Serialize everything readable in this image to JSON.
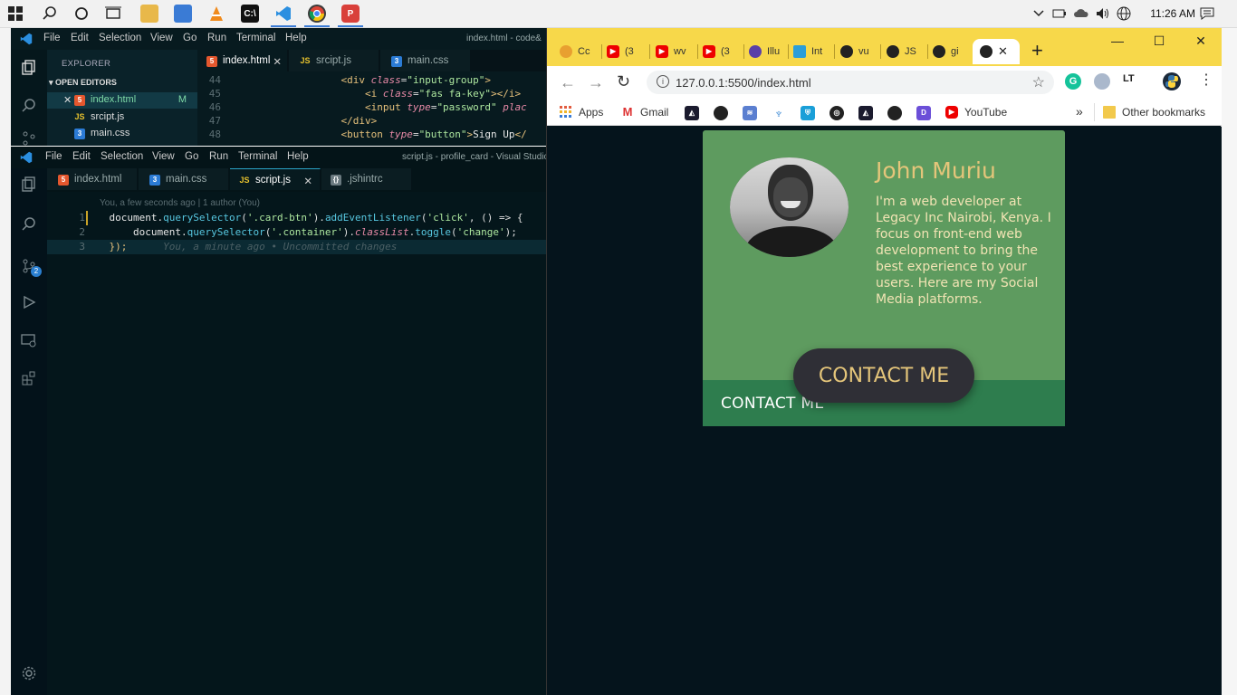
{
  "taskbar": {
    "clock": "11:26 AM"
  },
  "vscode_top": {
    "menu": [
      "File",
      "Edit",
      "Selection",
      "View",
      "Go",
      "Run",
      "Terminal",
      "Help"
    ],
    "title": "index.html - code&",
    "explorer_label": "EXPLORER",
    "open_editors_label": "OPEN EDITORS",
    "files": [
      {
        "name": "index.html",
        "status": "M"
      },
      {
        "name": "srcipt.js"
      },
      {
        "name": "main.css"
      }
    ],
    "tabs": [
      "index.html",
      "srcipt.js",
      "main.css"
    ],
    "code_lines": [
      {
        "n": "44",
        "tag_open": "<div ",
        "attr": "class",
        "eq": "=",
        "val": "\"input-group\"",
        "close": ">"
      },
      {
        "n": "45",
        "tag_open": "<i ",
        "attr": "class",
        "eq": "=",
        "val": "\"fas fa-key\"",
        "close": "></i>"
      },
      {
        "n": "46",
        "tag_open": "<input ",
        "attr": "type",
        "eq": "=",
        "val": "\"password\"",
        "rest": " plac"
      },
      {
        "n": "47",
        "tag_open": "</div>"
      },
      {
        "n": "48",
        "tag_open": "<button ",
        "attr": "type",
        "eq": "=",
        "val": "\"button\"",
        "close": ">",
        "text": "Sign Up",
        "end": "</"
      }
    ]
  },
  "vscode_bottom": {
    "menu": [
      "File",
      "Edit",
      "Selection",
      "View",
      "Go",
      "Run",
      "Terminal",
      "Help"
    ],
    "title": "script.js - profile_card - Visual Studio",
    "tabs": [
      "index.html",
      "main.css",
      "script.js",
      ".jshintrc"
    ],
    "blame": "You, a few seconds ago | 1 author (You)",
    "badge": "2",
    "lines": [
      {
        "n": "1",
        "a": "document.",
        "fn": "querySelector",
        "b": "(",
        "s": "'.card-btn'",
        "c": ").",
        "fn2": "addEventListener",
        "d": "(",
        "s2": "'click'",
        "e": ", () => {"
      },
      {
        "n": "2",
        "a": "    document.",
        "fn": "querySelector",
        "b": "(",
        "s": "'.container'",
        "c": ").",
        "fn2": "classList",
        "d": ".",
        "fn3": "toggle",
        "f": "(",
        "s2": "'change'",
        "e": ");"
      },
      {
        "n": "3",
        "a": "});",
        "hint": "You, a minute ago • Uncommitted changes"
      }
    ]
  },
  "chrome": {
    "tabs": [
      "Cc",
      "(3",
      "wv",
      "(3",
      "Illu",
      "Int",
      "vu",
      "JS",
      "gi"
    ],
    "url": "127.0.0.1:5500/index.html",
    "bookmarks": [
      {
        "label": "Apps"
      },
      {
        "label": "Gmail"
      },
      {
        "label": "YouTube"
      }
    ],
    "bookmarks_more": "»",
    "other_bookmarks": "Other bookmarks"
  },
  "card": {
    "name": "John Muriu",
    "bio": "I'm a web developer at Legacy Inc Nairobi, Kenya. I focus on front-end web development to bring the best experience to your users. Here are my Social Media platforms.",
    "button_label": "CONTACT ME",
    "footer_label": "CONTACT ME"
  },
  "colors": {
    "card_bg": "#5e9b5f",
    "card_footer": "#2e7d4e",
    "name_color": "#e4c57a",
    "button_bg": "#2f2f36",
    "chrome_frame": "#f7d84a",
    "page_bg": "#05141c"
  }
}
